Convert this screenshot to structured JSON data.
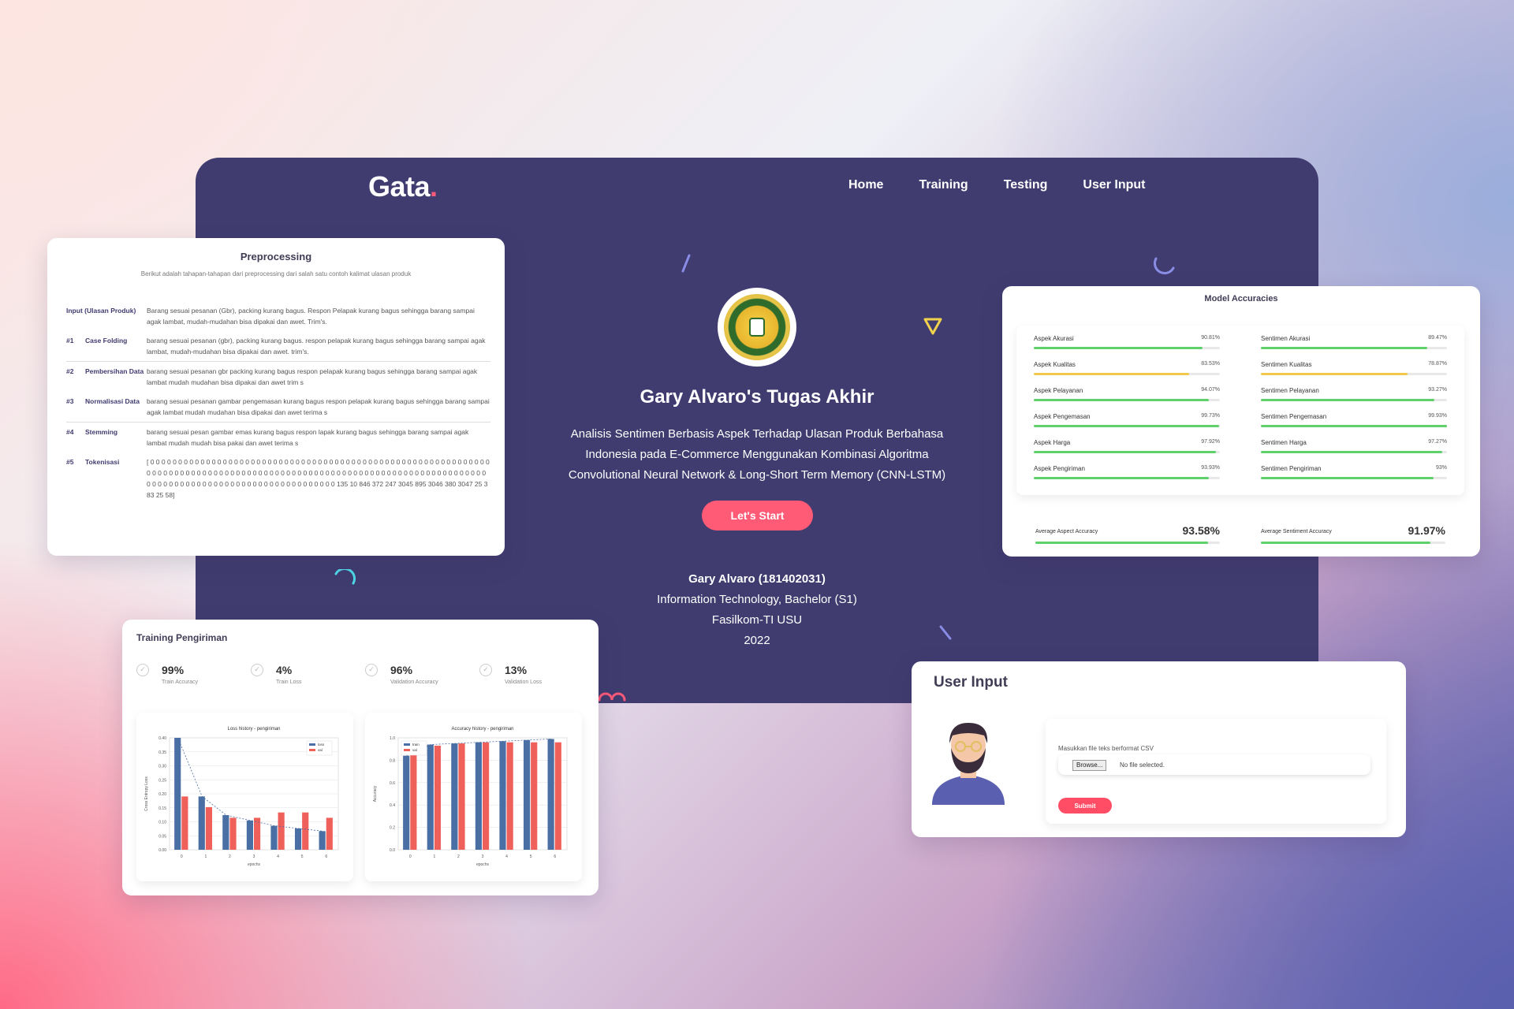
{
  "hero": {
    "logo_text": "Gata",
    "logo_dot": ".",
    "nav": [
      "Home",
      "Training",
      "Testing",
      "User Input"
    ],
    "title": "Gary Alvaro's Tugas Akhir",
    "description": "Analisis Sentimen Berbasis Aspek Terhadap Ulasan Produk Berbahasa Indonesia pada E-Commerce Menggunakan Kombinasi Algoritma Convolutional Neural Network & Long-Short Term Memory (CNN-LSTM)",
    "cta": "Let's Start",
    "author_name": "Gary Alvaro (181402031)",
    "author_program": "Information Technology, Bachelor (S1)",
    "author_faculty": "Fasilkom-TI USU",
    "author_year": "2022"
  },
  "preprocessing": {
    "title": "Preprocessing",
    "subtitle": "Berikut adalah tahapan-tahapan dari preprocessing dari salah satu contoh kalimat ulasan produk",
    "input_label": "Input (Ulasan Produk)",
    "input_value": "Barang sesuai pesanan (Gbr), packing kurang bagus. Respon Pelapak kurang bagus sehingga barang sampai agak lambat, mudah-mudahan bisa dipakai dan awet. Trim's.",
    "steps": [
      {
        "num": "#1",
        "label": "Case Folding",
        "value": "barang sesuai pesanan (gbr), packing kurang bagus. respon pelapak kurang bagus sehingga barang sampai agak lambat, mudah-mudahan bisa dipakai dan awet. trim's."
      },
      {
        "num": "#2",
        "label": "Pembersihan Data",
        "value": "barang sesuai pesanan gbr packing kurang bagus respon pelapak kurang bagus sehingga barang sampai agak lambat mudah mudahan bisa dipakai dan awet trim s"
      },
      {
        "num": "#3",
        "label": "Normalisasi Data",
        "value": "barang sesuai pesanan gambar pengemasan kurang bagus respon pelapak kurang bagus sehingga barang sampai agak lambat mudah mudahan bisa dipakai dan awet terima s"
      },
      {
        "num": "#4",
        "label": "Stemming",
        "value": "barang sesuai pesan gambar emas kurang bagus respon lapak kurang bagus sehingga barang sampai agak lambat mudah mudah bisa pakai dan awet terima s"
      },
      {
        "num": "#5",
        "label": "Tokenisasi",
        "value": "[ 0 0 0 0 0 0 0 0 0 0 0 0 0 0 0 0 0 0 0 0 0 0 0 0 0 0 0 0 0 0 0 0 0 0 0 0 0 0 0 0 0 0 0 0 0 0 0 0 0 0 0 0 0 0 0 0 0 0 0 0 0 0 0 0 0 0 0 0 0 0 0 0 0 0 0 0 0 0 0 0 0 0 0 0 0 0 0 0 0 0 0 0 0 0 0 0 0 0 0 0 0 0 0 0 0 0 0 0 0 0 0 0 0 0 0 0 0 0 0 0 0 0 0 0 0 0 0 0 0 0 0 0 0 0 0 0 0 0 0 0 0 0 0 0 0 0 0 0 0 0 0 0 0 0 0 0 135 10 846 372 247 3045 895 3046 380 3047 25 383 25 58]"
      }
    ]
  },
  "accuracies": {
    "title": "Model Accuracies",
    "aspects": [
      {
        "label": "Aspek Akurasi",
        "value": "90.81%",
        "fill": 0.908,
        "color": "#5fd16a"
      },
      {
        "label": "Aspek Kualitas",
        "value": "83.53%",
        "fill": 0.835,
        "color": "#f2c94c"
      },
      {
        "label": "Aspek Pelayanan",
        "value": "94.07%",
        "fill": 0.94,
        "color": "#5fd16a"
      },
      {
        "label": "Aspek Pengemasan",
        "value": "99.73%",
        "fill": 0.997,
        "color": "#5fd16a"
      },
      {
        "label": "Aspek Harga",
        "value": "97.92%",
        "fill": 0.979,
        "color": "#5fd16a"
      },
      {
        "label": "Aspek Pengiriman",
        "value": "93.93%",
        "fill": 0.939,
        "color": "#5fd16a"
      }
    ],
    "sentiments": [
      {
        "label": "Sentimen Akurasi",
        "value": "89.47%",
        "fill": 0.895,
        "color": "#5fd16a"
      },
      {
        "label": "Sentimen Kualitas",
        "value": "78.87%",
        "fill": 0.789,
        "color": "#f2c94c"
      },
      {
        "label": "Sentimen Pelayanan",
        "value": "93.27%",
        "fill": 0.933,
        "color": "#5fd16a"
      },
      {
        "label": "Sentimen Pengemasan",
        "value": "99.93%",
        "fill": 0.999,
        "color": "#5fd16a"
      },
      {
        "label": "Sentimen Harga",
        "value": "97.27%",
        "fill": 0.973,
        "color": "#5fd16a"
      },
      {
        "label": "Sentimen Pengiriman",
        "value": "93%",
        "fill": 0.93,
        "color": "#5fd16a"
      }
    ],
    "avg_aspect_label": "Average Aspect Accuracy",
    "avg_aspect_value": "93.58%",
    "avg_aspect_fill": 0.936,
    "avg_sentiment_label": "Average Sentiment Accuracy",
    "avg_sentiment_value": "91.97%",
    "avg_sentiment_fill": 0.92
  },
  "training": {
    "title": "Training Pengiriman",
    "stats": [
      {
        "value": "99%",
        "label": "Train Accuracy"
      },
      {
        "value": "4%",
        "label": "Train Loss"
      },
      {
        "value": "96%",
        "label": "Validation Accuracy"
      },
      {
        "value": "13%",
        "label": "Validation Loss"
      }
    ]
  },
  "chart_data": [
    {
      "type": "bar",
      "title": "Loss history - pengiriman",
      "xlabel": "epochs",
      "ylabel": "Cross Entropy Loss",
      "categories": [
        "0",
        "1",
        "2",
        "3",
        "4",
        "5",
        "6"
      ],
      "series": [
        {
          "name": "loss",
          "color": "#4a6fa5",
          "values": [
            0.42,
            0.2,
            0.13,
            0.11,
            0.09,
            0.08,
            0.07
          ]
        },
        {
          "name": "val",
          "color": "#f0605a",
          "values": [
            0.2,
            0.16,
            0.12,
            0.12,
            0.14,
            0.14,
            0.12
          ]
        }
      ],
      "ylim": [
        0,
        0.42
      ],
      "yticks": [
        "0.00",
        "0.05",
        "0.10",
        "0.15",
        "0.20",
        "0.25",
        "0.30",
        "0.35",
        "0.40"
      ]
    },
    {
      "type": "bar",
      "title": "Accuracy history - pengiriman",
      "xlabel": "epochs",
      "ylabel": "Accuracy",
      "categories": [
        "0",
        "1",
        "2",
        "3",
        "4",
        "5",
        "6"
      ],
      "series": [
        {
          "name": "train",
          "color": "#4a6fa5",
          "values": [
            0.84,
            0.94,
            0.95,
            0.96,
            0.97,
            0.98,
            0.99
          ]
        },
        {
          "name": "val",
          "color": "#f0605a",
          "values": [
            0.88,
            0.93,
            0.95,
            0.96,
            0.96,
            0.96,
            0.96
          ]
        }
      ],
      "ylim": [
        0,
        1.0
      ],
      "yticks": [
        "0.0",
        "0.2",
        "0.4",
        "0.6",
        "0.8",
        "1.0"
      ]
    }
  ],
  "user_input": {
    "title": "User Input",
    "field_label": "Masukkan file teks berformat CSV",
    "browse_label": "Browse...",
    "file_status": "No file selected.",
    "submit_label": "Submit"
  }
}
